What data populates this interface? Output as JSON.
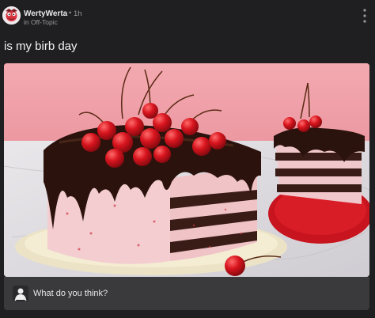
{
  "post": {
    "author": "WertyWerta",
    "separator": "•",
    "time_ago": "1h",
    "community": "in Off-Topic",
    "title": "is my birb day",
    "media": {
      "description_icon": "photo"
    }
  },
  "comment_bar": {
    "prompt": "What do you think?"
  },
  "icons": {
    "menu": "vertical-dots-icon",
    "avatar": "author-avatar",
    "comment_avatar": "user-silhouette-icon"
  },
  "colors": {
    "background": "#1f1f21",
    "comment_bar": "#3a3a3d",
    "muted_text": "#9a9a9e",
    "avatar_accent": "#d8333f"
  }
}
